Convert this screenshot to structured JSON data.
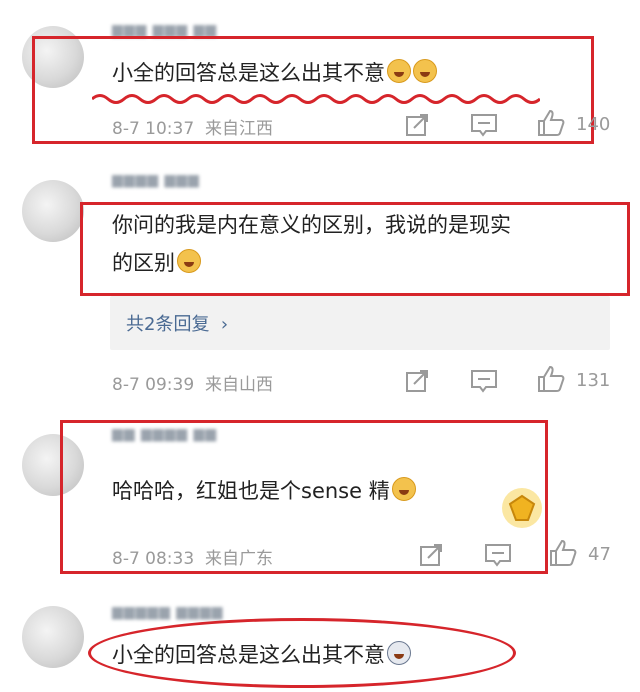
{
  "comments": [
    {
      "text": "小全的回答总是这么出其不意",
      "time": "8-7 10:37",
      "location": "来自江西",
      "likes": "140"
    },
    {
      "text_line1": "你问的我是内在意义的区别，我说的是现实",
      "text_line2": "的区别",
      "replies_label": "共2条回复",
      "time": "8-7 09:39",
      "location": "来自山西",
      "likes": "131"
    },
    {
      "text": "哈哈哈，红姐也是个sense 精",
      "time": "8-7 08:33",
      "location": "来自广东",
      "likes": "47"
    },
    {
      "text": "小全的回答总是这么出其不意"
    }
  ],
  "colors": {
    "highlight": "#d6252b",
    "meta": "#9a9a9a",
    "link": "#4a6a93"
  },
  "icons": [
    "share-icon",
    "comment-icon",
    "like-icon",
    "chevron-right-icon"
  ]
}
